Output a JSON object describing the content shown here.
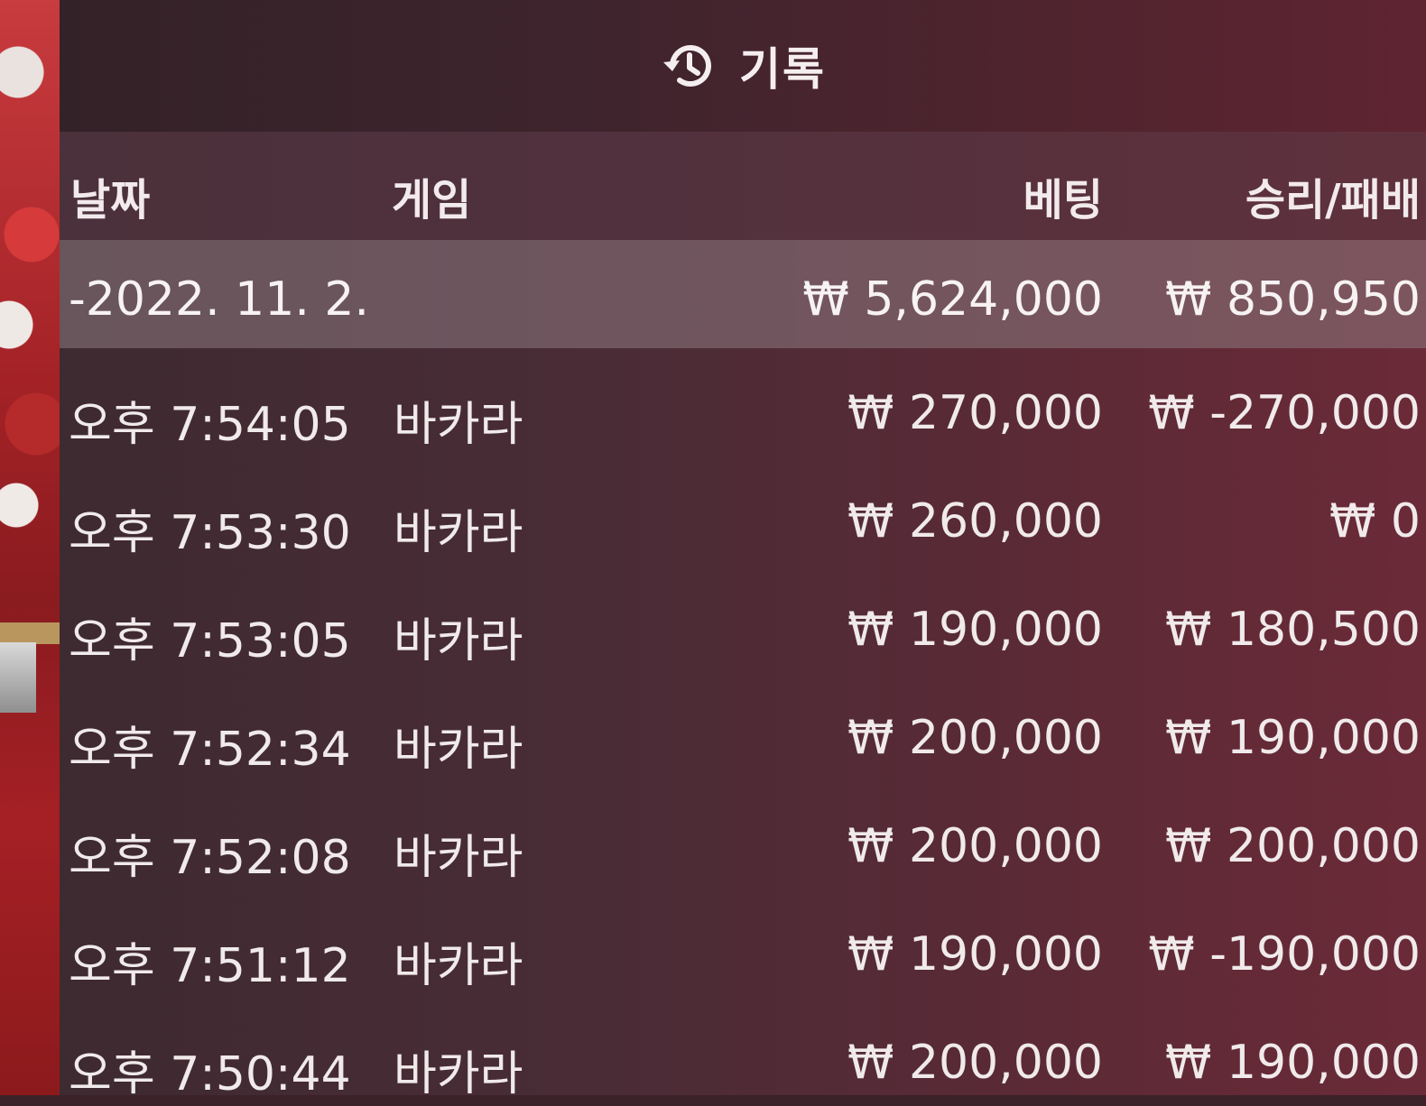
{
  "header": {
    "icon": "history-icon",
    "title": "기록"
  },
  "columns": {
    "date": "날짜",
    "game": "게임",
    "bet": "베팅",
    "winloss": "승리/패배"
  },
  "summary": {
    "date": "-2022. 11. 2.",
    "bet": "₩ 5,624,000",
    "winloss": "₩ 850,950"
  },
  "rows": [
    {
      "time": "오후 7:54:05",
      "game": "바카라",
      "bet": "₩ 270,000",
      "winloss": "₩ -270,000"
    },
    {
      "time": "오후 7:53:30",
      "game": "바카라",
      "bet": "₩ 260,000",
      "winloss": "₩ 0"
    },
    {
      "time": "오후 7:53:05",
      "game": "바카라",
      "bet": "₩ 190,000",
      "winloss": "₩ 180,500"
    },
    {
      "time": "오후 7:52:34",
      "game": "바카라",
      "bet": "₩ 200,000",
      "winloss": "₩ 190,000"
    },
    {
      "time": "오후 7:52:08",
      "game": "바카라",
      "bet": "₩ 200,000",
      "winloss": "₩ 200,000"
    },
    {
      "time": "오후 7:51:12",
      "game": "바카라",
      "bet": "₩ 190,000",
      "winloss": "₩ -190,000"
    },
    {
      "time": "오후 7:50:44",
      "game": "바카라",
      "bet": "₩ 200,000",
      "winloss": "₩ 190,000"
    }
  ]
}
